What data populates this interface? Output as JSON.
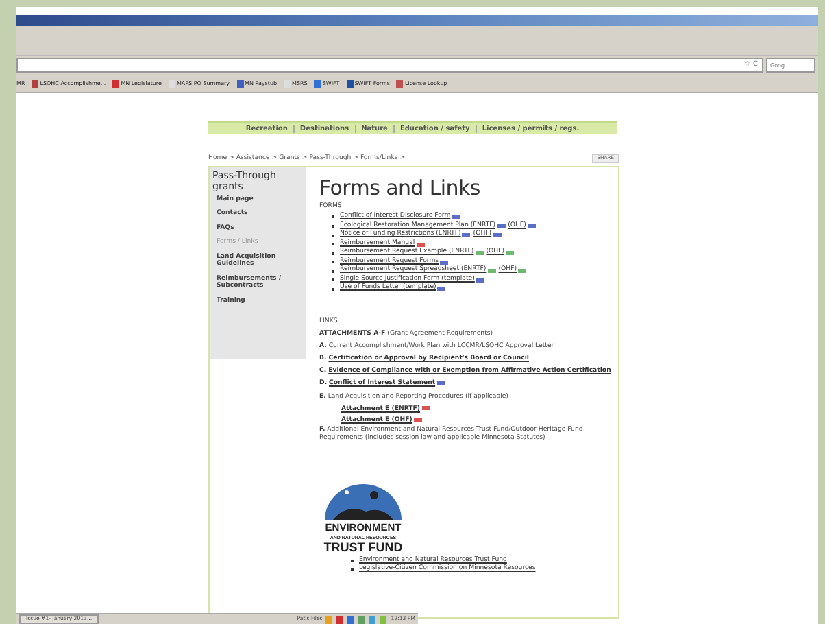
{
  "browser": {
    "address_buttons": [
      "☆",
      "C"
    ],
    "search_placeholder": "Goog",
    "bookmarks": [
      "MR",
      "LSOHC Accomplishme...",
      "MN Legislature",
      "MAPS PO Summary",
      "MN Paystub",
      "MSRS",
      "SWIFT",
      "SWIFT Forms",
      "License Lookup"
    ]
  },
  "nav": [
    "Recreation",
    "Destinations",
    "Nature",
    "Education / safety",
    "Licenses / permits / regs."
  ],
  "breadcrumb": "Home > Assistance > Grants > Pass-Through > Forms/Links >",
  "share": "SHARE",
  "sidebar": {
    "title": "Pass-Through grants",
    "items": [
      {
        "label": "Main page",
        "selected": false
      },
      {
        "label": "Contacts",
        "selected": false
      },
      {
        "label": "FAQs",
        "selected": false
      },
      {
        "label": "Forms / Links",
        "selected": true
      },
      {
        "label": "Land Acquisition Guidelines",
        "selected": false
      },
      {
        "label": "Reimbursements / Subcontracts",
        "selected": false
      },
      {
        "label": "Training",
        "selected": false
      }
    ]
  },
  "title": "Forms and Links",
  "forms_heading": "FORMS",
  "forms": [
    {
      "parts": [
        {
          "text": "Conflict of Interest Disclosure Form",
          "icon": {
            "kind": "doc"
          }
        }
      ]
    },
    {
      "parts": [
        {
          "text": "Ecological Restoration Management Plan (ENRTF)",
          "icon": {
            "kind": "doc"
          }
        },
        {
          "text": "(OHF)",
          "icon": {
            "kind": "doc"
          }
        }
      ]
    },
    {
      "parts": [
        {
          "text": "Notice of Funding Restrictions (ENRTF)",
          "icon": {
            "kind": "doc"
          }
        },
        {
          "text": "(OHF)",
          "icon": {
            "kind": "doc"
          }
        }
      ]
    },
    {
      "parts": [
        {
          "text": "Reimbursement Manual",
          "icon": {
            "kind": "pdf"
          }
        }
      ],
      "after": ","
    },
    {
      "parts": [
        {
          "text": "Reimbursement Request Example (ENRTF)",
          "icon": {
            "kind": "xls"
          }
        },
        {
          "text": "(OHF)",
          "icon": {
            "kind": "xls"
          }
        }
      ]
    },
    {
      "parts": [
        {
          "text": "Reimbursement Request Forms",
          "icon": {
            "kind": "doc"
          }
        }
      ]
    },
    {
      "parts": [
        {
          "text": "Reimbursement Request Spreadsheet (ENRTF)",
          "icon": {
            "kind": "xls"
          }
        },
        {
          "text": "(OHF)",
          "icon": {
            "kind": "xls"
          }
        }
      ]
    },
    {
      "parts": [
        {
          "text": "Single Source Justification Form (template)",
          "icon": {
            "kind": "doc"
          }
        }
      ]
    },
    {
      "parts": [
        {
          "text": "Use of Funds Letter (template)",
          "icon": {
            "kind": "doc"
          }
        }
      ]
    }
  ],
  "links_heading": "LINKS",
  "attachments_heading": {
    "label": "ATTACHMENTS A-F",
    "note": "(Grant Agreement Requirements)"
  },
  "attachments": [
    {
      "letter": "A.",
      "kind": "text",
      "text": "Current Accomplishment/Work Plan with LCCMR/LSOHC Approval Letter"
    },
    {
      "letter": "B.",
      "kind": "link",
      "text": "Certification or Approval by Recipient's Board or Council"
    },
    {
      "letter": "C.",
      "kind": "link",
      "text": "Evidence of Compliance with or Exemption from Affirmative Action Certification"
    },
    {
      "letter": "D.",
      "kind": "link",
      "text": "Conflict of Interest Statement",
      "icon": {
        "kind": "doc"
      }
    },
    {
      "letter": "E.",
      "kind": "text",
      "text": "Land Acquisition and Reporting Procedures (if applicable)",
      "sub": [
        {
          "text": "Attachment E (ENRTF)",
          "icon": {
            "kind": "pdf"
          }
        },
        {
          "text": "Attachment E (OHF)",
          "icon": {
            "kind": "pdf"
          }
        }
      ]
    },
    {
      "letter": "F.",
      "kind": "text",
      "text": "Additional Environment and Natural Resources Trust Fund/Outdoor Heritage Fund Requirements (includes session law and applicable Minnesota Statutes)"
    }
  ],
  "logo": {
    "line1": "ENVIRONMENT",
    "line2": "AND NATURAL RESOURCES",
    "line3": "TRUST FUND"
  },
  "bottom_links": [
    "Environment and Natural Resources Trust Fund",
    "Legislative-Citizen Commission on Minnesota Resources"
  ],
  "taskbar": {
    "task": "Issue #1- January 2013...",
    "folder": "Pat's Files",
    "clock": "12:13 PM"
  }
}
